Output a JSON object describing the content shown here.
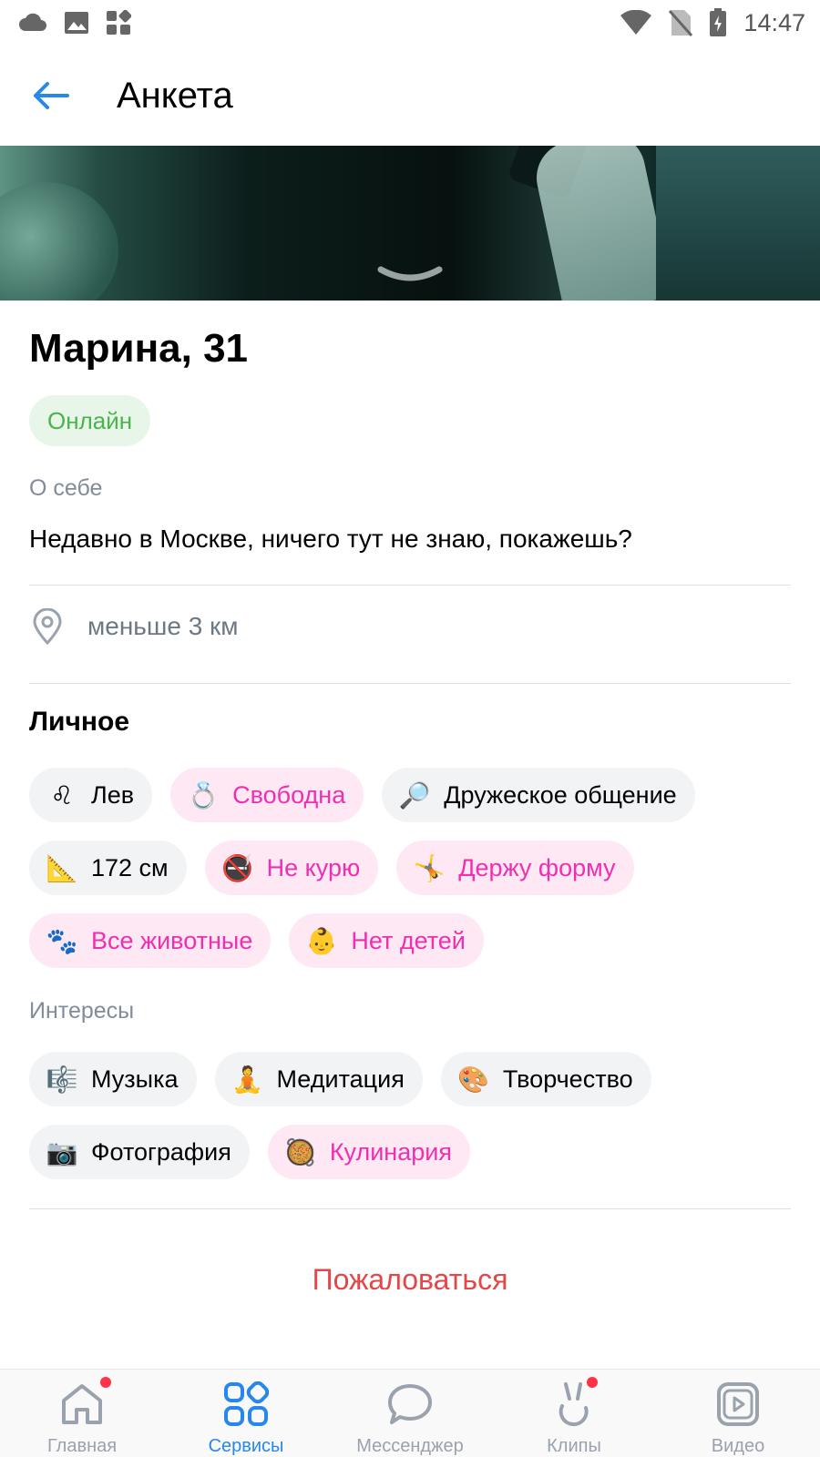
{
  "status_bar": {
    "time": "14:47"
  },
  "header": {
    "title": "Анкета"
  },
  "profile": {
    "name_age": "Марина, 31",
    "online": "Онлайн",
    "about_label": "О себе",
    "about_text": "Недавно в Москве, ничего тут не знаю, покажешь?",
    "distance": "меньше 3 км"
  },
  "personal": {
    "title": "Личное",
    "chips": [
      {
        "icon": "♌",
        "label": "Лев",
        "highlight": false
      },
      {
        "icon": "💍",
        "label": "Свободна",
        "highlight": true
      },
      {
        "icon": "🔎",
        "label": "Дружеское общение",
        "highlight": false
      },
      {
        "icon": "📐",
        "label": "172 см",
        "highlight": false
      },
      {
        "icon": "🚭",
        "label": "Не курю",
        "highlight": true
      },
      {
        "icon": "🤸",
        "label": "Держу форму",
        "highlight": true
      },
      {
        "icon": "🐾",
        "label": "Все животные",
        "highlight": true
      },
      {
        "icon": "👶",
        "label": "Нет детей",
        "highlight": true
      }
    ]
  },
  "interests": {
    "title": "Интересы",
    "chips": [
      {
        "icon": "🎼",
        "label": "Музыка",
        "highlight": false
      },
      {
        "icon": "🧘",
        "label": "Медитация",
        "highlight": false
      },
      {
        "icon": "🎨",
        "label": "Творчество",
        "highlight": false
      },
      {
        "icon": "📷",
        "label": "Фотография",
        "highlight": false
      },
      {
        "icon": "🥘",
        "label": "Кулинария",
        "highlight": true
      }
    ]
  },
  "actions": {
    "report": "Пожаловаться"
  },
  "bottom_nav": {
    "items": [
      {
        "label": "Главная",
        "icon": "home-icon",
        "active": false,
        "dot": true
      },
      {
        "label": "Сервисы",
        "icon": "services-icon",
        "active": true,
        "dot": false
      },
      {
        "label": "Мессенджер",
        "icon": "messenger-icon",
        "active": false,
        "dot": false
      },
      {
        "label": "Клипы",
        "icon": "clips-icon",
        "active": false,
        "dot": true
      },
      {
        "label": "Видео",
        "icon": "video-icon",
        "active": false,
        "dot": false
      }
    ]
  },
  "colors": {
    "accent": "#2688eb",
    "online_green": "#4bb34b",
    "chip_pink_text": "#ef2fb0",
    "chip_pink_bg": "#fde8f4",
    "report_red": "#e64646",
    "notification_dot": "#ff3347"
  }
}
